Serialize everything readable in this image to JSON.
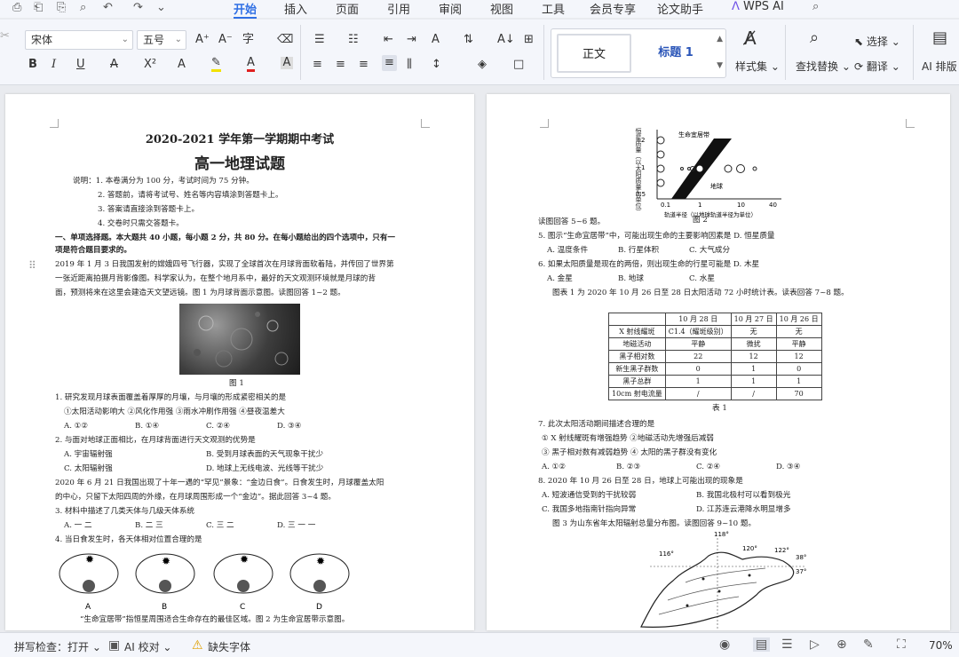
{
  "menubar": {
    "quick_access": [
      "⎙",
      "⎗",
      "⎘",
      "↶",
      "↷"
    ],
    "tabs": [
      "开始",
      "插入",
      "页面",
      "引用",
      "审阅",
      "视图",
      "工具",
      "会员专享",
      "论文助手",
      "WPS AI"
    ],
    "active_tab": "开始"
  },
  "ribbon": {
    "font_name": "宋体",
    "font_size": "五号",
    "row1_icons": [
      "A⁺",
      "A⁻",
      "⌘",
      "⌫"
    ],
    "row2_icons": [
      "B",
      "I",
      "U",
      "A",
      "X²",
      "A",
      "A",
      "A",
      "A"
    ],
    "para_icons_row1": [
      "☰",
      "☰",
      "⇤",
      "⇥",
      "A",
      "↕",
      "A↓",
      "⊞"
    ],
    "para_icons_row2": [
      "≡",
      "≡",
      "≡",
      "≡",
      "⫼",
      "↕",
      "◈",
      "□"
    ],
    "style_normal": "正文",
    "style_heading1": "标题 1",
    "styles_label": "样式集",
    "find_replace": "查找替换",
    "select": "选择",
    "translate": "翻译",
    "ai_layout": "AI 排版"
  },
  "left_page": {
    "title": "2020-2021 学年第一学期期中考试",
    "subtitle": "高一地理试题",
    "notes": [
      "说明：1. 本卷满分为 100 分，考试时间为 75 分钟。",
      "2. 答题前，请将考试号、姓名等内容填涂到答题卡上。",
      "3. 答案请直接涂到答题卡上。",
      "4. 交卷时只需交答题卡。"
    ],
    "section1a": "一、单项选择题。本大题共 40 小题，每小题 2 分，共 80 分。在每小题给出的四个选项中，只有一",
    "section1b": "项是符合题目要求的。",
    "para1": [
      "2019 年 1 月 3 日我国发射的嫦娥四号飞行器，实现了全球首次在月球背面软着陆，并传回了世界第",
      "一张近距离拍摄月背影像图。科学家认为，在整个地月系中，最好的天文观测环境就是月球的背",
      "面，预测将来在这里会建造天文望远镜。图 1 为月球背面示意图。读图回答 1~2 题。"
    ],
    "fig1_caption": "图 1",
    "q1": "1. 研究发现月球表面覆盖着厚厚的月壤，与月壤的形成紧密相关的是",
    "q1_opts": "①太阳活动影响大  ②风化作用强  ③雨水冲刷作用强  ④昼夜温差大",
    "q1_choices": [
      "A. ①②",
      "B. ①④",
      "C. ②④",
      "D. ③④"
    ],
    "q2": "2. 与面对地球正面相比，在月球背面进行天文观测的优势是",
    "q2_choices": [
      "A. 宇宙辐射强",
      "B. 受到月球表面的天气现象干扰少",
      "C. 太阳辐射强",
      "D. 地球上无线电波、光线等干扰少"
    ],
    "para2": [
      "2020 年 6 月 21 日我国出现了十年一遇的“罕见”景象：“金边日食”。日食发生时，月球覆盖太阳",
      "的中心，只留下太阳四周的外缘，在月球周围形成一个“金边”。据此回答 3~4 题。"
    ],
    "q3": "3. 材料中描述了几类天体与几级天体系统",
    "q3_choices": [
      "A. 一 二",
      "B. 二 三",
      "C. 三 二",
      "D. 三 一 一"
    ],
    "q4": "4. 当日食发生时，各天体相对位置合理的是",
    "q4_labels": [
      "A",
      "B",
      "C",
      "D"
    ],
    "last_line": "“生命宜居带”指恒星周围适合生命存在的最佳区域。图 2 为生命宜居带示意图。"
  },
  "right_page": {
    "fig2_ylabel": "恒星质量（以太阳质量为单位）",
    "fig2_band": "生命宜居带",
    "fig2_earth": "地球",
    "fig2_y_ticks": [
      "2",
      "1",
      "0.5"
    ],
    "fig2_x_ticks": [
      "0.1",
      "1",
      "10",
      "40"
    ],
    "fig2_xlabel": "轨道半径（以地球轨道半径为单位）",
    "fig2_caption": "图 2",
    "read5": "读图回答 5~6 题。",
    "q5": "5. 图示“生命宜居带”中，可能出现生命的主要影响因素是    D. 恒星质量",
    "q5_choices": [
      "A. 温度条件",
      "B. 行星体积",
      "C. 大气成分"
    ],
    "q6": "6. 如果太阳质量是现在的两倍，则出现生命的行星可能是    D. 木星",
    "q6_choices": [
      "A. 金星",
      "B. 地球",
      "C. 水星"
    ],
    "table_intro": "图表 1 为 2020 年 10 月 26 日至 28 日太阳活动 72 小时统计表。读表回答 7~8 题。",
    "table": {
      "header": [
        "",
        "10 月 28 日",
        "10 月 27 日",
        "10 月 26 日"
      ],
      "rows": [
        [
          "X 射线耀斑",
          "C1.4（耀斑级别）",
          "无",
          "无"
        ],
        [
          "地磁活动",
          "平静",
          "微扰",
          "平静"
        ],
        [
          "黑子相对数",
          "22",
          "12",
          "12"
        ],
        [
          "新生黑子群数",
          "0",
          "1",
          "0"
        ],
        [
          "黑子总群",
          "1",
          "1",
          "1"
        ],
        [
          "10cm 射电流量",
          "/",
          "/",
          "70"
        ]
      ]
    },
    "table_caption": "表 1",
    "q7": "7. 此次太阳活动期间描述合理的是",
    "q7_opts1": "① X 射线耀斑有增强趋势        ②地磁活动先增强后减弱",
    "q7_opts2": "③ 黑子相对数有减弱趋势        ④ 太阳的黑子群没有变化",
    "q7_choices": [
      "A. ①②",
      "B. ②③",
      "C. ②④",
      "D. ③④"
    ],
    "q8": "8. 2020 年 10 月 26 日至 28 日，地球上可能出现的现象是",
    "q8_choices": [
      "A. 短波通信受到的干扰较弱",
      "B. 我国北极村可以看到极光",
      "C. 我国多地指南针指向异常",
      "D. 江苏连云港降水明显增多"
    ],
    "fig3_intro": "图 3 为山东省年太阳辐射总量分布图。读图回答 9~10 题。",
    "fig3_lon": [
      "118°",
      "116°",
      "120°",
      "122°"
    ],
    "fig3_lat": [
      "38°",
      "37°"
    ]
  },
  "statusbar": {
    "spellcheck": "拼写检查：打开",
    "ai_check": "AI 校对",
    "missing_font": "缺失字体",
    "zoom": "70%"
  }
}
